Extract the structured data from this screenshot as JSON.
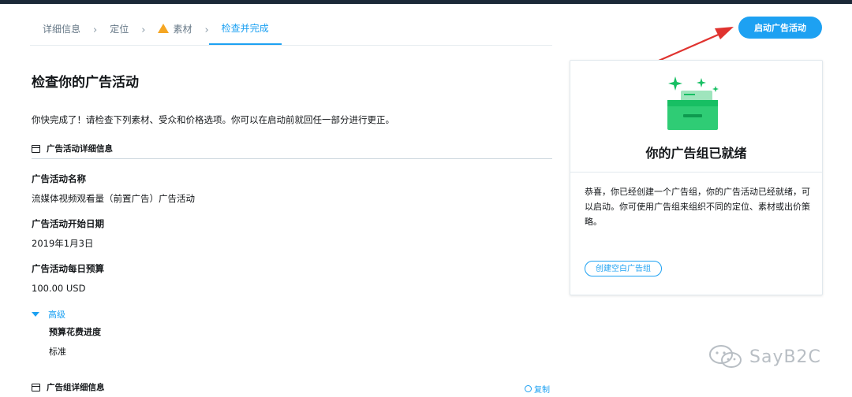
{
  "breadcrumb": {
    "items": [
      "详细信息",
      "定位",
      "素材",
      "检查并完成"
    ]
  },
  "header": {
    "launch_label": "启动广告活动"
  },
  "main": {
    "title": "检查你的广告活动",
    "intro": "你快完成了！请检查下列素材、受众和价格选项。你可以在启动前就回任一部分进行更正。",
    "campaign_section": "广告活动详细信息",
    "fields": [
      {
        "label": "广告活动名称",
        "value": "流媒体视频观看量（前置广告）广告活动"
      },
      {
        "label": "广告活动开始日期",
        "value": "2019年1月3日"
      },
      {
        "label": "广告活动每日预算",
        "value": "100.00 USD"
      }
    ],
    "advanced": {
      "label": "高级",
      "pacing_label": "预算花费进度",
      "pacing_value": "标准"
    },
    "adgroup_section": "广告组详细信息",
    "copy_label": "复制"
  },
  "card": {
    "title": "你的广告组已就绪",
    "body": "恭喜，你已经创建一个广告组，你的广告活动已经就绪，可以启动。你可使用广告组来组织不同的定位、素材或出价策略。",
    "button_label": "创建空白广告组"
  },
  "watermark": {
    "text": "SayB2C"
  },
  "colors": {
    "accent": "#1da1f2",
    "warning": "#f5a623",
    "illustration": "#17bf63",
    "annotation_arrow": "#e0332f"
  }
}
